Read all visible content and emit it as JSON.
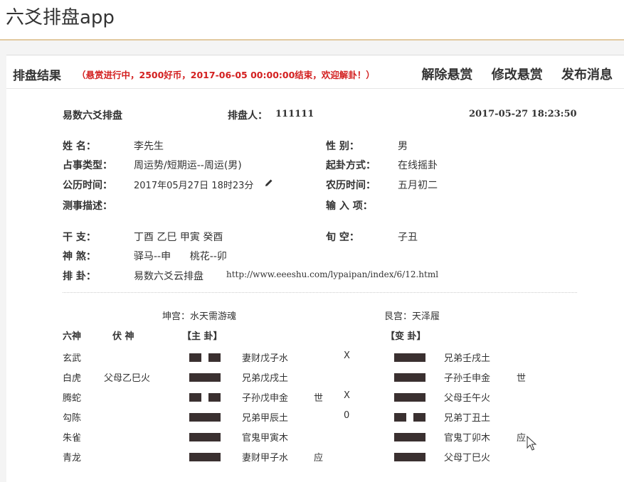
{
  "app_title": "六爻排盘app",
  "panel": {
    "title": "排盘结果",
    "bounty": "（悬赏进行中，2500好币，2017-06-05 00:00:00结束，欢迎解卦！）",
    "actions": [
      "解除悬赏",
      "修改悬赏",
      "发布消息"
    ]
  },
  "header": {
    "app_name": "易数六爻排盘",
    "author_label": "排盘人：",
    "author": "111111",
    "datetime": "2017-05-27  18:23:50"
  },
  "info": {
    "name_label": "姓    名：",
    "name": "李先生",
    "gender_label": "性    别：",
    "gender": "男",
    "type_label": "占事类型：",
    "type": "周运势/短期运--周运(男)",
    "method_label": "起卦方式：",
    "method": "在线摇卦",
    "solar_label": "公历时间：",
    "solar": "2017年05月27日  18时23分",
    "lunar_label": "农历时间：",
    "lunar": "五月初二",
    "desc_label": "测事描述：",
    "desc": "",
    "input_label": "输 入 项：",
    "input": "",
    "ganzhi_label": "干    支：",
    "ganzhi": "丁酉  乙巳  甲寅  癸酉",
    "xunkong_label": "旬    空：",
    "xunkong": "子丑",
    "shensha_label": "神    煞：",
    "shensha": "驿马--申      桃花--卯",
    "paigua_label": "排    卦：",
    "paigua": "易数六爻云排盘",
    "url": "http://www.eeeshu.com/lypaipan/index/6/12.html"
  },
  "gua": {
    "main_palace": "坤宫：水天需游魂",
    "change_palace": "艮宫：天泽履",
    "col_liushen": "六神",
    "col_fushen": "伏 神",
    "col_main": "【主  卦】",
    "col_change": "【变  卦】",
    "rows": [
      {
        "shen": "玄武",
        "fu": "",
        "main": "broken",
        "mname": "妻财戊子水",
        "shi": "",
        "mark": "X",
        "change": "solid",
        "cname": "兄弟壬戌土",
        "cshi": ""
      },
      {
        "shen": "白虎",
        "fu": "父母乙巳火",
        "main": "solid",
        "mname": "兄弟戊戌土",
        "shi": "",
        "mark": "",
        "change": "solid",
        "cname": "子孙壬申金",
        "cshi": "世"
      },
      {
        "shen": "腾蛇",
        "fu": "",
        "main": "broken",
        "mname": "子孙戊申金",
        "shi": "世",
        "mark": "X",
        "change": "solid",
        "cname": "父母壬午火",
        "cshi": ""
      },
      {
        "shen": "勾陈",
        "fu": "",
        "main": "solid",
        "mname": "兄弟甲辰土",
        "shi": "",
        "mark": "0",
        "change": "broken",
        "cname": "兄弟丁丑土",
        "cshi": ""
      },
      {
        "shen": "朱雀",
        "fu": "",
        "main": "solid",
        "mname": "官鬼甲寅木",
        "shi": "",
        "mark": "",
        "change": "solid",
        "cname": "官鬼丁卯木",
        "cshi": "应"
      },
      {
        "shen": "青龙",
        "fu": "",
        "main": "solid",
        "mname": "妻财甲子水",
        "shi": "应",
        "mark": "",
        "change": "solid",
        "cname": "父母丁巳火",
        "cshi": ""
      }
    ]
  }
}
